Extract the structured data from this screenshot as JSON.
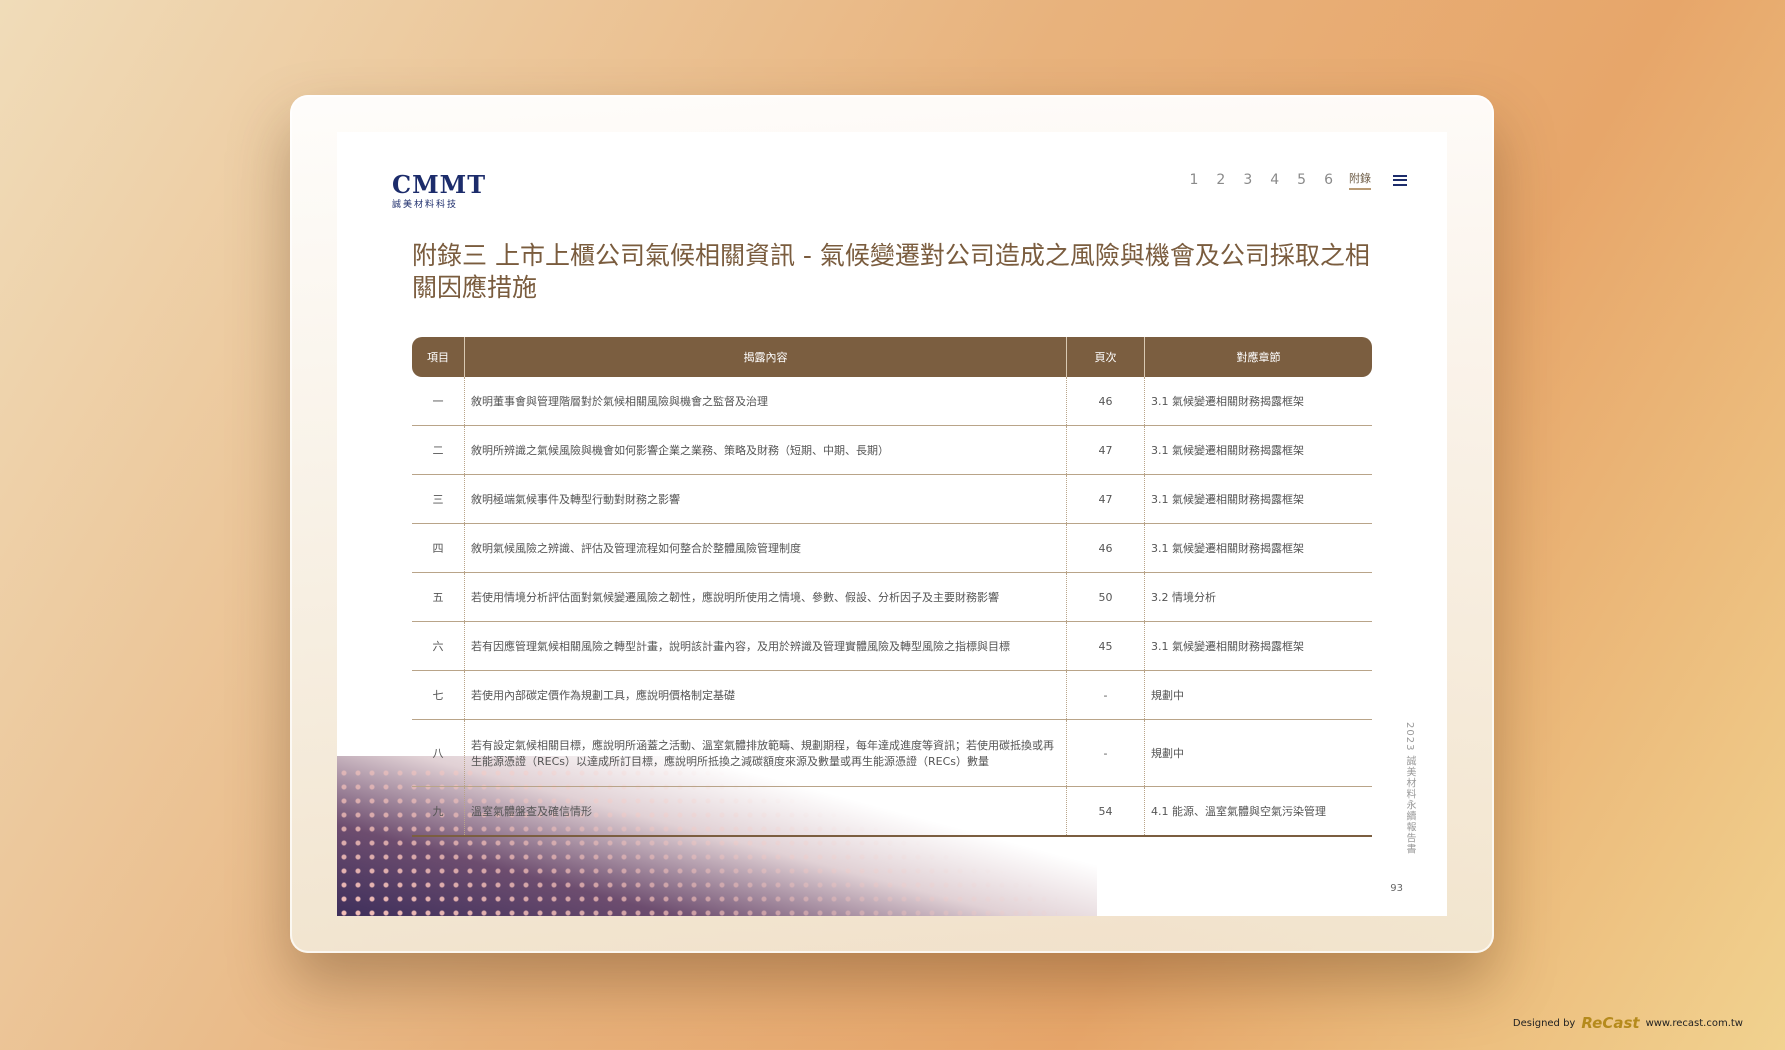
{
  "header": {
    "logo_text": "CMMT",
    "logo_sub": "誠美材料科技",
    "nav_items": [
      "1",
      "2",
      "3",
      "4",
      "5",
      "6"
    ],
    "nav_appendix": "附錄"
  },
  "title": "附錄三 上市上櫃公司氣候相關資訊 - 氣候變遷對公司造成之風險與機會及公司採取之相關因應措施",
  "table": {
    "headers": [
      "項目",
      "揭露內容",
      "頁次",
      "對應章節"
    ],
    "rows": [
      {
        "item": "一",
        "content": "敘明董事會與管理階層對於氣候相關風險與機會之監督及治理",
        "page": "46",
        "section": "3.1 氣候變遷相關財務揭露框架"
      },
      {
        "item": "二",
        "content": "敘明所辨識之氣候風險與機會如何影響企業之業務、策略及財務（短期、中期、長期）",
        "page": "47",
        "section": "3.1 氣候變遷相關財務揭露框架"
      },
      {
        "item": "三",
        "content": "敘明極端氣候事件及轉型行動對財務之影響",
        "page": "47",
        "section": "3.1 氣候變遷相關財務揭露框架"
      },
      {
        "item": "四",
        "content": "敘明氣候風險之辨識、評估及管理流程如何整合於整體風險管理制度",
        "page": "46",
        "section": "3.1 氣候變遷相關財務揭露框架"
      },
      {
        "item": "五",
        "content": "若使用情境分析評估面對氣候變遷風險之韌性，應說明所使用之情境、參數、假設、分析因子及主要財務影響",
        "page": "50",
        "section": "3.2 情境分析"
      },
      {
        "item": "六",
        "content": "若有因應管理氣候相關風險之轉型計畫，說明該計畫內容，及用於辨識及管理實體風險及轉型風險之指標與目標",
        "page": "45",
        "section": "3.1 氣候變遷相關財務揭露框架"
      },
      {
        "item": "七",
        "content": "若使用內部碳定價作為規劃工具，應說明價格制定基礎",
        "page": "-",
        "section": "規劃中"
      },
      {
        "item": "八",
        "content": "若有設定氣候相關目標，應說明所涵蓋之活動、溫室氣體排放範疇、規劃期程，每年達成進度等資訊；若使用碳抵換或再生能源憑證（RECs）以達成所訂目標，應說明所抵換之減碳額度來源及數量或再生能源憑證（RECs）數量",
        "page": "-",
        "section": "規劃中"
      },
      {
        "item": "九",
        "content": "溫室氣體盤查及確信情形",
        "page": "54",
        "section": "4.1 能源、溫室氣體與空氣污染管理"
      }
    ]
  },
  "side_text": "2023 誠美材料永續報告書",
  "page_number": "93",
  "credit": {
    "prefix": "Designed by",
    "brand": "ReCast",
    "url": "www.recast.com.tw"
  }
}
